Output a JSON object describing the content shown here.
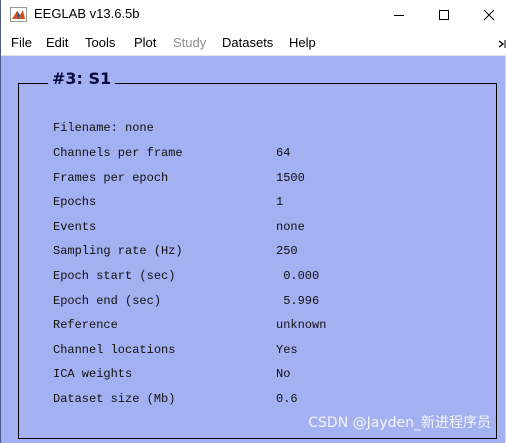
{
  "window": {
    "title": "EEGLAB v13.6.5b",
    "icon": "matlab-icon",
    "controls": [
      "minimize-icon",
      "maximize-icon",
      "close-icon"
    ]
  },
  "menu": {
    "items": [
      {
        "label": "File",
        "enabled": true
      },
      {
        "label": "Edit",
        "enabled": true
      },
      {
        "label": "Tools",
        "enabled": true
      },
      {
        "label": "Plot",
        "enabled": true
      },
      {
        "label": "Study",
        "enabled": false
      },
      {
        "label": "Datasets",
        "enabled": true
      },
      {
        "label": "Help",
        "enabled": true
      }
    ],
    "overflow_icon": "toolbar-overflow-icon"
  },
  "dataset": {
    "title": "#3: S1",
    "filename_line": "Filename: none",
    "rows": [
      {
        "label": "Channels per frame",
        "value": "64"
      },
      {
        "label": "Frames per epoch",
        "value": "1500"
      },
      {
        "label": "Epochs",
        "value": "1"
      },
      {
        "label": "Events",
        "value": "none"
      },
      {
        "label": "Sampling rate (Hz)",
        "value": "250"
      },
      {
        "label": "Epoch start (sec)",
        "value": " 0.000"
      },
      {
        "label": "Epoch end (sec)",
        "value": " 5.996"
      },
      {
        "label": "Reference",
        "value": "unknown"
      },
      {
        "label": "Channel locations",
        "value": "Yes"
      },
      {
        "label": "ICA weights",
        "value": "No"
      },
      {
        "label": "Dataset size (Mb)",
        "value": "0.6"
      }
    ]
  },
  "watermark": "CSDN @Jayden_新进程序员",
  "colors": {
    "background": "#a3b1f2",
    "title_text": "#0a0a3c",
    "disabled_menu": "#8c8c8c"
  }
}
